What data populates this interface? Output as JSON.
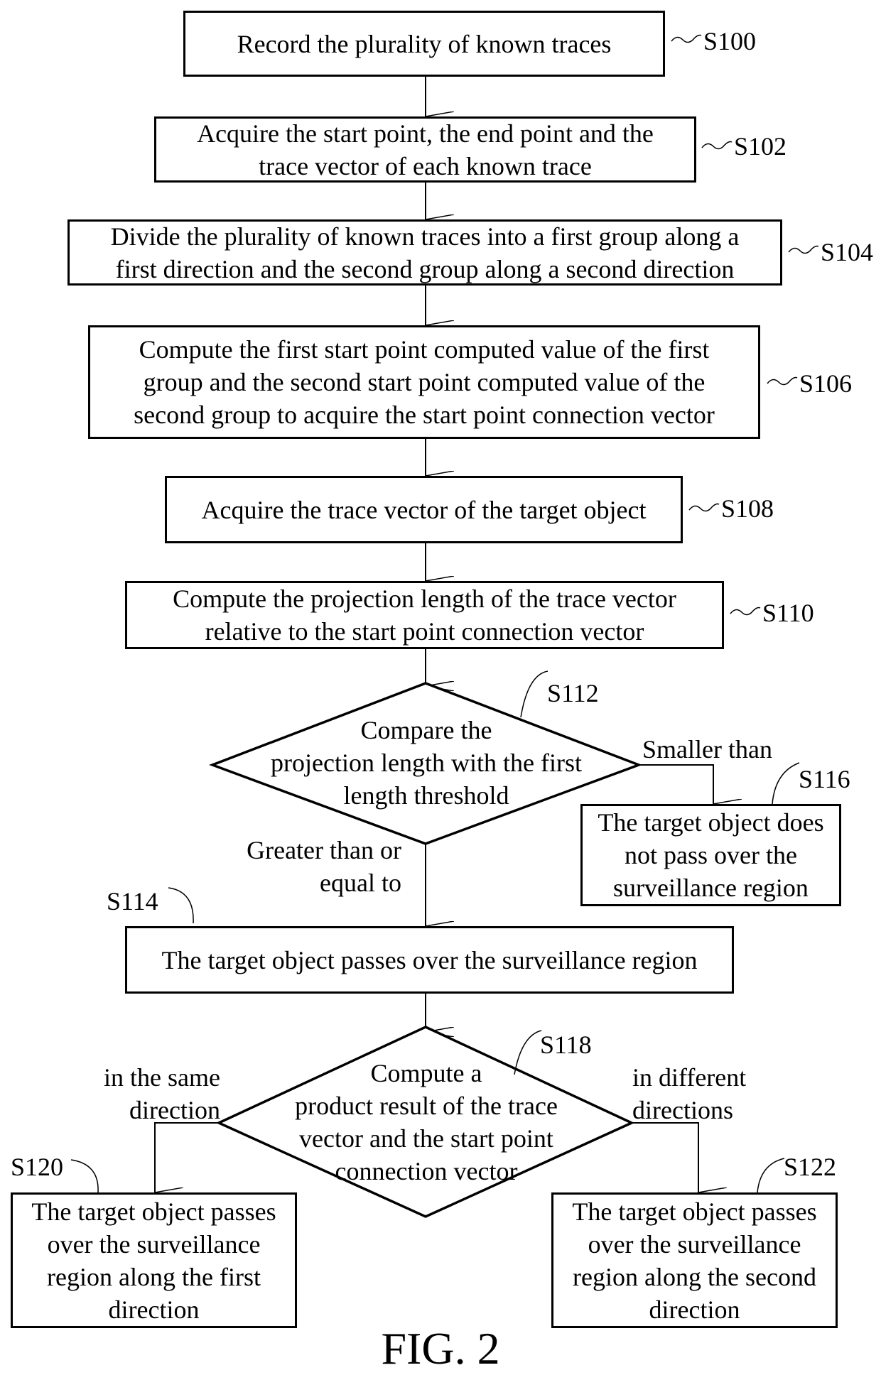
{
  "figure_label": "FIG. 2",
  "steps": {
    "s100": {
      "id": "S100",
      "text": "Record the plurality of known traces"
    },
    "s102": {
      "id": "S102",
      "lines": [
        "Acquire the start point, the end point and the",
        "trace vector of each known trace"
      ]
    },
    "s104": {
      "id": "S104",
      "lines": [
        "Divide the plurality of known traces into a first group along a",
        "first direction and the second group along a second direction"
      ]
    },
    "s106": {
      "id": "S106",
      "lines": [
        "Compute the first start point computed value of the first",
        "group and the second start point computed value of the",
        "second group to acquire the start point connection vector"
      ]
    },
    "s108": {
      "id": "S108",
      "text": "Acquire the trace vector of the target object"
    },
    "s110": {
      "id": "S110",
      "lines": [
        "Compute the projection length of the trace vector",
        "relative to the start point connection vector"
      ]
    },
    "s112": {
      "id": "S112",
      "lines": [
        "Compare the",
        "projection length with the first",
        "length threshold"
      ]
    },
    "s114": {
      "id": "S114",
      "text": "The target object passes over the surveillance region"
    },
    "s116": {
      "id": "S116",
      "lines": [
        "The target object does",
        "not pass over the",
        "surveillance region"
      ]
    },
    "s118": {
      "id": "S118",
      "lines": [
        "Compute a",
        "product result of the trace",
        "vector and the start point",
        "connection vector"
      ]
    },
    "s120": {
      "id": "S120",
      "lines": [
        "The target object passes",
        "over the surveillance",
        "region along the first",
        "direction"
      ]
    },
    "s122": {
      "id": "S122",
      "lines": [
        "The target object passes",
        "over the surveillance",
        "region along the second",
        "direction"
      ]
    }
  },
  "branch_labels": {
    "smaller": "Smaller than",
    "greater": [
      "Greater than or",
      "equal to"
    ],
    "same": [
      "in the same",
      "direction"
    ],
    "different": [
      "in different",
      "directions"
    ]
  }
}
